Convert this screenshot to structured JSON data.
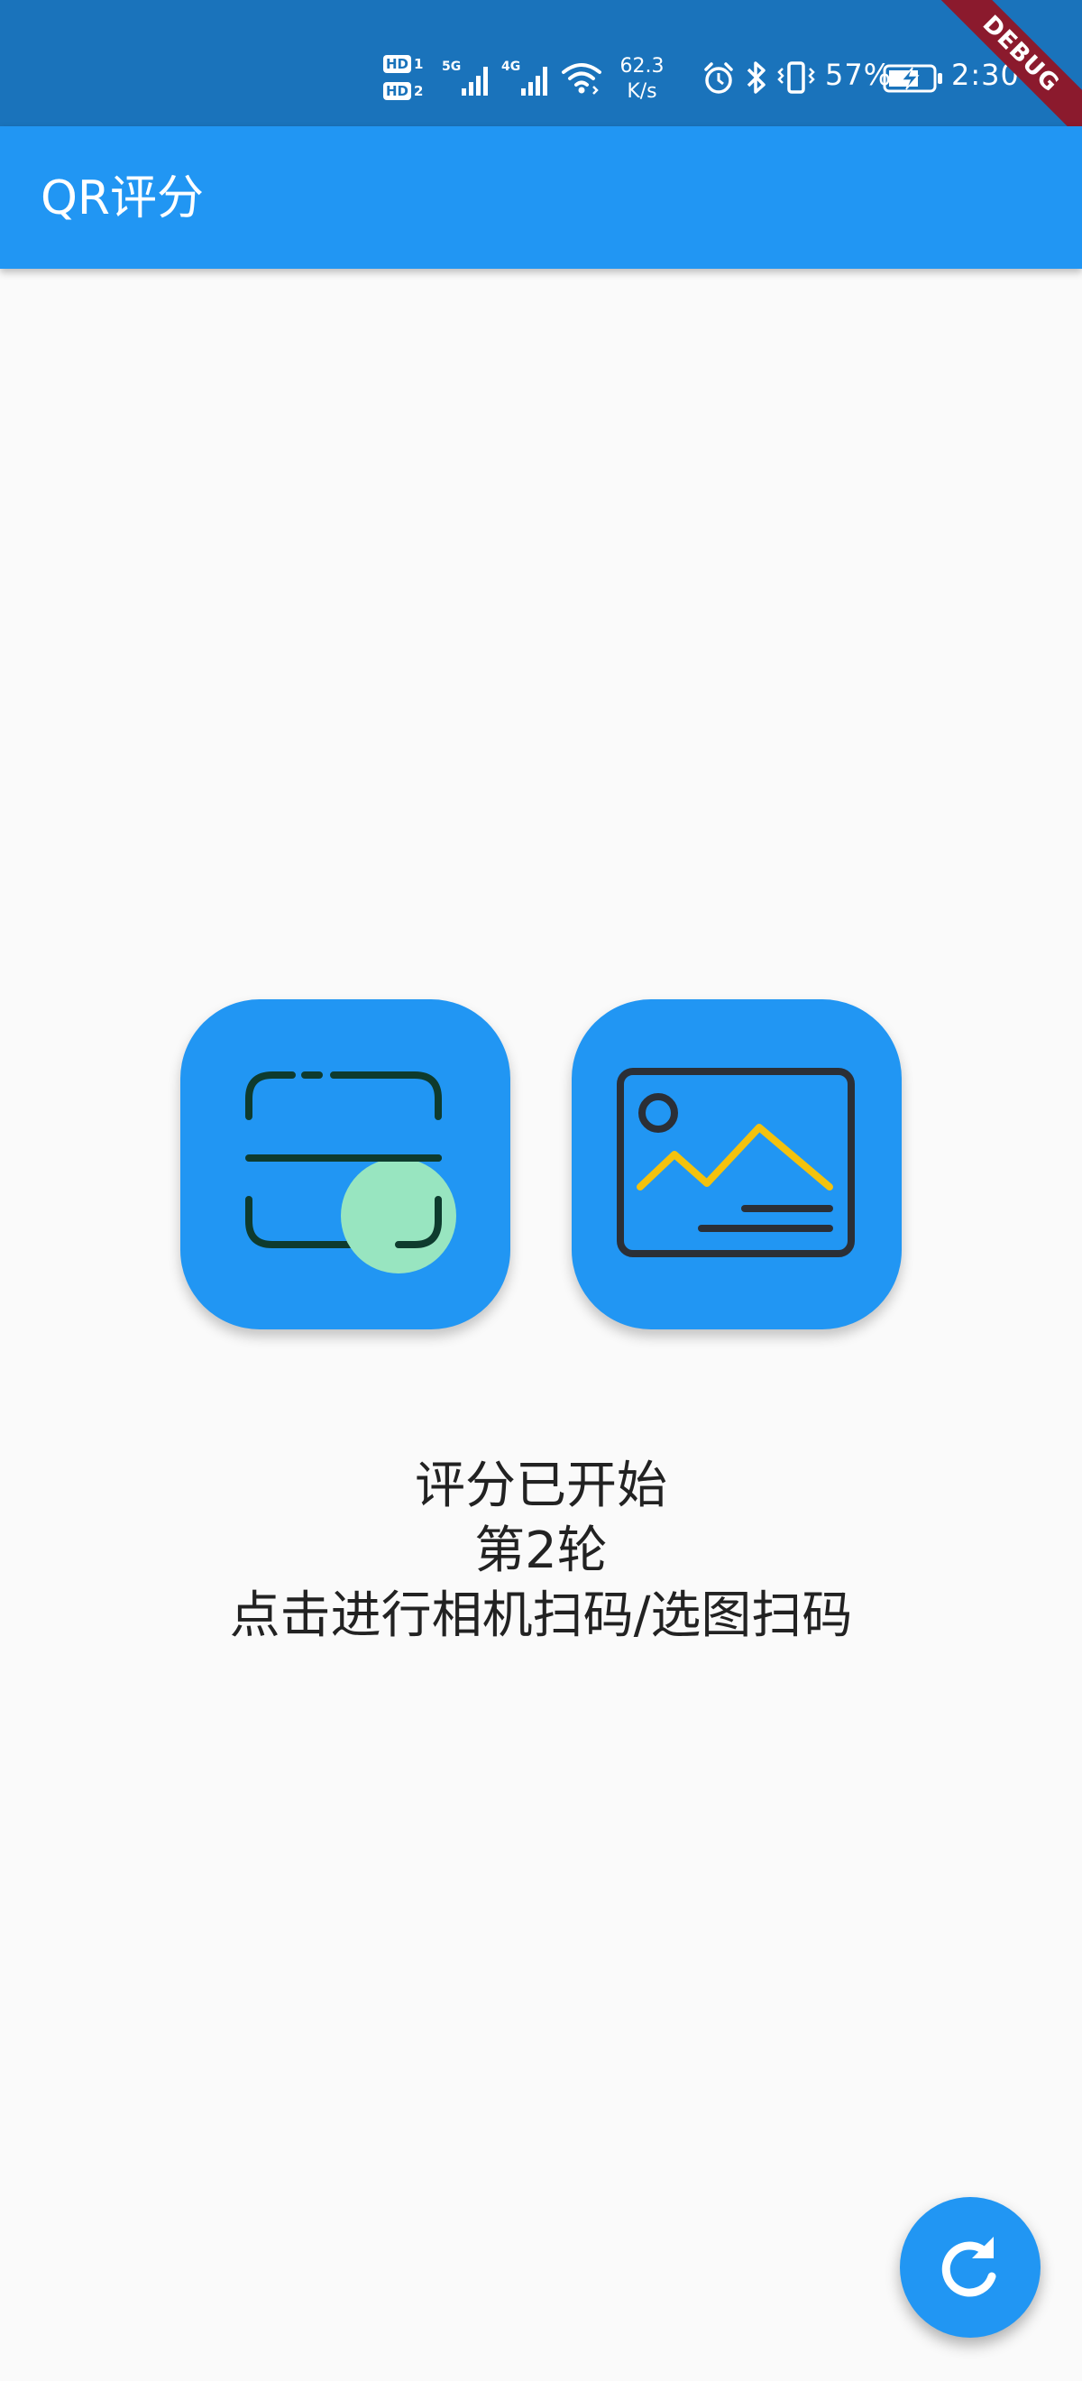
{
  "status_bar": {
    "hd1": "HD",
    "hd1_num": "1",
    "hd2": "HD",
    "hd2_num": "2",
    "net1": "5G",
    "net2": "4G",
    "speed_value": "62.3",
    "speed_unit": "K/s",
    "battery": "57%",
    "time": "2:30",
    "debug": "DEBUG",
    "bg_color": "#1a73bb"
  },
  "app_bar": {
    "title": "QR评分",
    "color": "#2196f3"
  },
  "actions": {
    "camera_scan_icon": "scan-icon",
    "gallery_pick_icon": "image-icon"
  },
  "status": {
    "line1": "评分已开始",
    "line2": "第2轮",
    "line3": "点击进行相机扫码/选图扫码"
  },
  "fab": {
    "icon": "refresh-icon"
  },
  "colors": {
    "accent": "#2196f3",
    "scan_dot": "#98e5c0",
    "scan_stroke": "#0e3b2e",
    "mountain": "#f4c20d",
    "frame_stroke": "#2b2f36"
  }
}
